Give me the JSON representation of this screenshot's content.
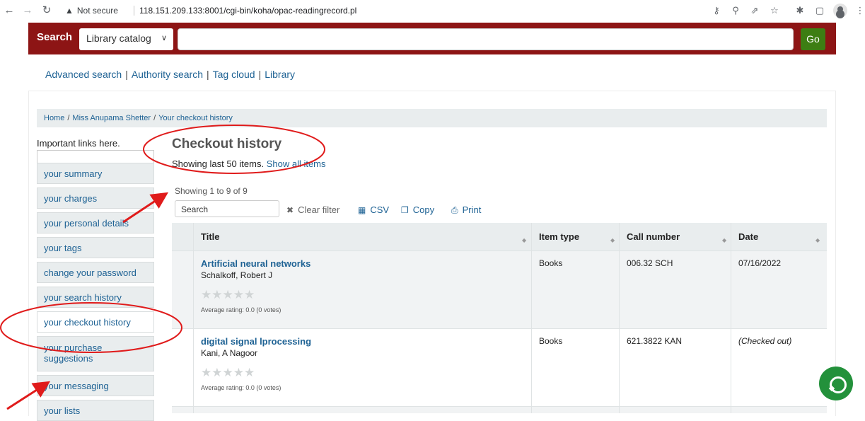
{
  "browser": {
    "security_label": "Not secure",
    "url": "118.151.209.133:8001/cgi-bin/koha/opac-readingrecord.pl"
  },
  "search": {
    "label": "Search",
    "scope": "Library catalog",
    "go_label": "Go"
  },
  "top_links": [
    "Advanced search",
    "Authority search",
    "Tag cloud",
    "Library"
  ],
  "breadcrumb": [
    "Home",
    "Miss Anupama Shetter",
    "Your checkout history"
  ],
  "sidebar": {
    "heading": "Important links here.",
    "items": [
      "your summary",
      "your charges",
      "your personal details",
      "your tags",
      "change your password",
      "your search history",
      "your checkout history",
      "your purchase suggestions",
      "your messaging",
      "your lists"
    ],
    "active_index": 6
  },
  "main": {
    "title": "Checkout history",
    "showing_last": "Showing last 50 items.",
    "show_all": "Show all items",
    "dt_info": "Showing 1 to 9 of 9",
    "search_placeholder": "Search",
    "clear_filter": "Clear filter",
    "csv": "CSV",
    "copy": "Copy",
    "print": "Print"
  },
  "table": {
    "headers": [
      "Title",
      "Item type",
      "Call number",
      "Date"
    ],
    "rows": [
      {
        "title": "Artificial neural networks",
        "author": "Schalkoff, Robert J",
        "rating": "Average rating: 0.0 (0 votes)",
        "item_type": "Books",
        "call_number": "006.32 SCH",
        "date": "07/16/2022"
      },
      {
        "title": "digital signal lprocessing",
        "author": "Kani, A Nagoor",
        "rating": "Average rating: 0.0 (0 votes)",
        "item_type": "Books",
        "call_number": "621.3822 KAN",
        "date": "(Checked out)"
      }
    ]
  },
  "colors": {
    "masthead": "#8d1515",
    "go_button": "#3d7e13",
    "link": "#1e6294",
    "annotation": "#e01b1b",
    "chat": "#23913b"
  }
}
